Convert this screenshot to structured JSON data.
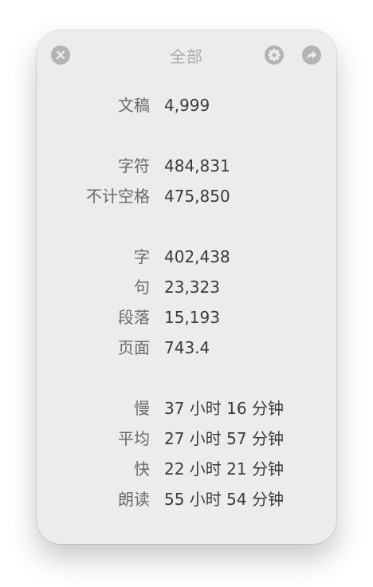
{
  "window": {
    "title": "全部",
    "accent_color": "#b4b4b4",
    "background_color": "#ececec"
  },
  "titlebar": {
    "close_icon": "close-icon",
    "settings_icon": "gear-icon",
    "share_icon": "share-arrow-icon"
  },
  "stats": {
    "documents": {
      "label": "文稿",
      "value": "4,999"
    },
    "characters": {
      "label": "字符",
      "value": "484,831"
    },
    "characters_no_spaces": {
      "label": "不计空格",
      "value": "475,850"
    },
    "words": {
      "label": "字",
      "value": "402,438"
    },
    "sentences": {
      "label": "句",
      "value": "23,323"
    },
    "paragraphs": {
      "label": "段落",
      "value": "15,193"
    },
    "pages": {
      "label": "页面",
      "value": "743.4"
    },
    "reading_slow": {
      "label": "慢",
      "value": "37 小时 16 分钟"
    },
    "reading_average": {
      "label": "平均",
      "value": "27 小时 57 分钟"
    },
    "reading_fast": {
      "label": "快",
      "value": "22 小时 21 分钟"
    },
    "reading_aloud": {
      "label": "朗读",
      "value": "55 小时 54 分钟"
    }
  }
}
